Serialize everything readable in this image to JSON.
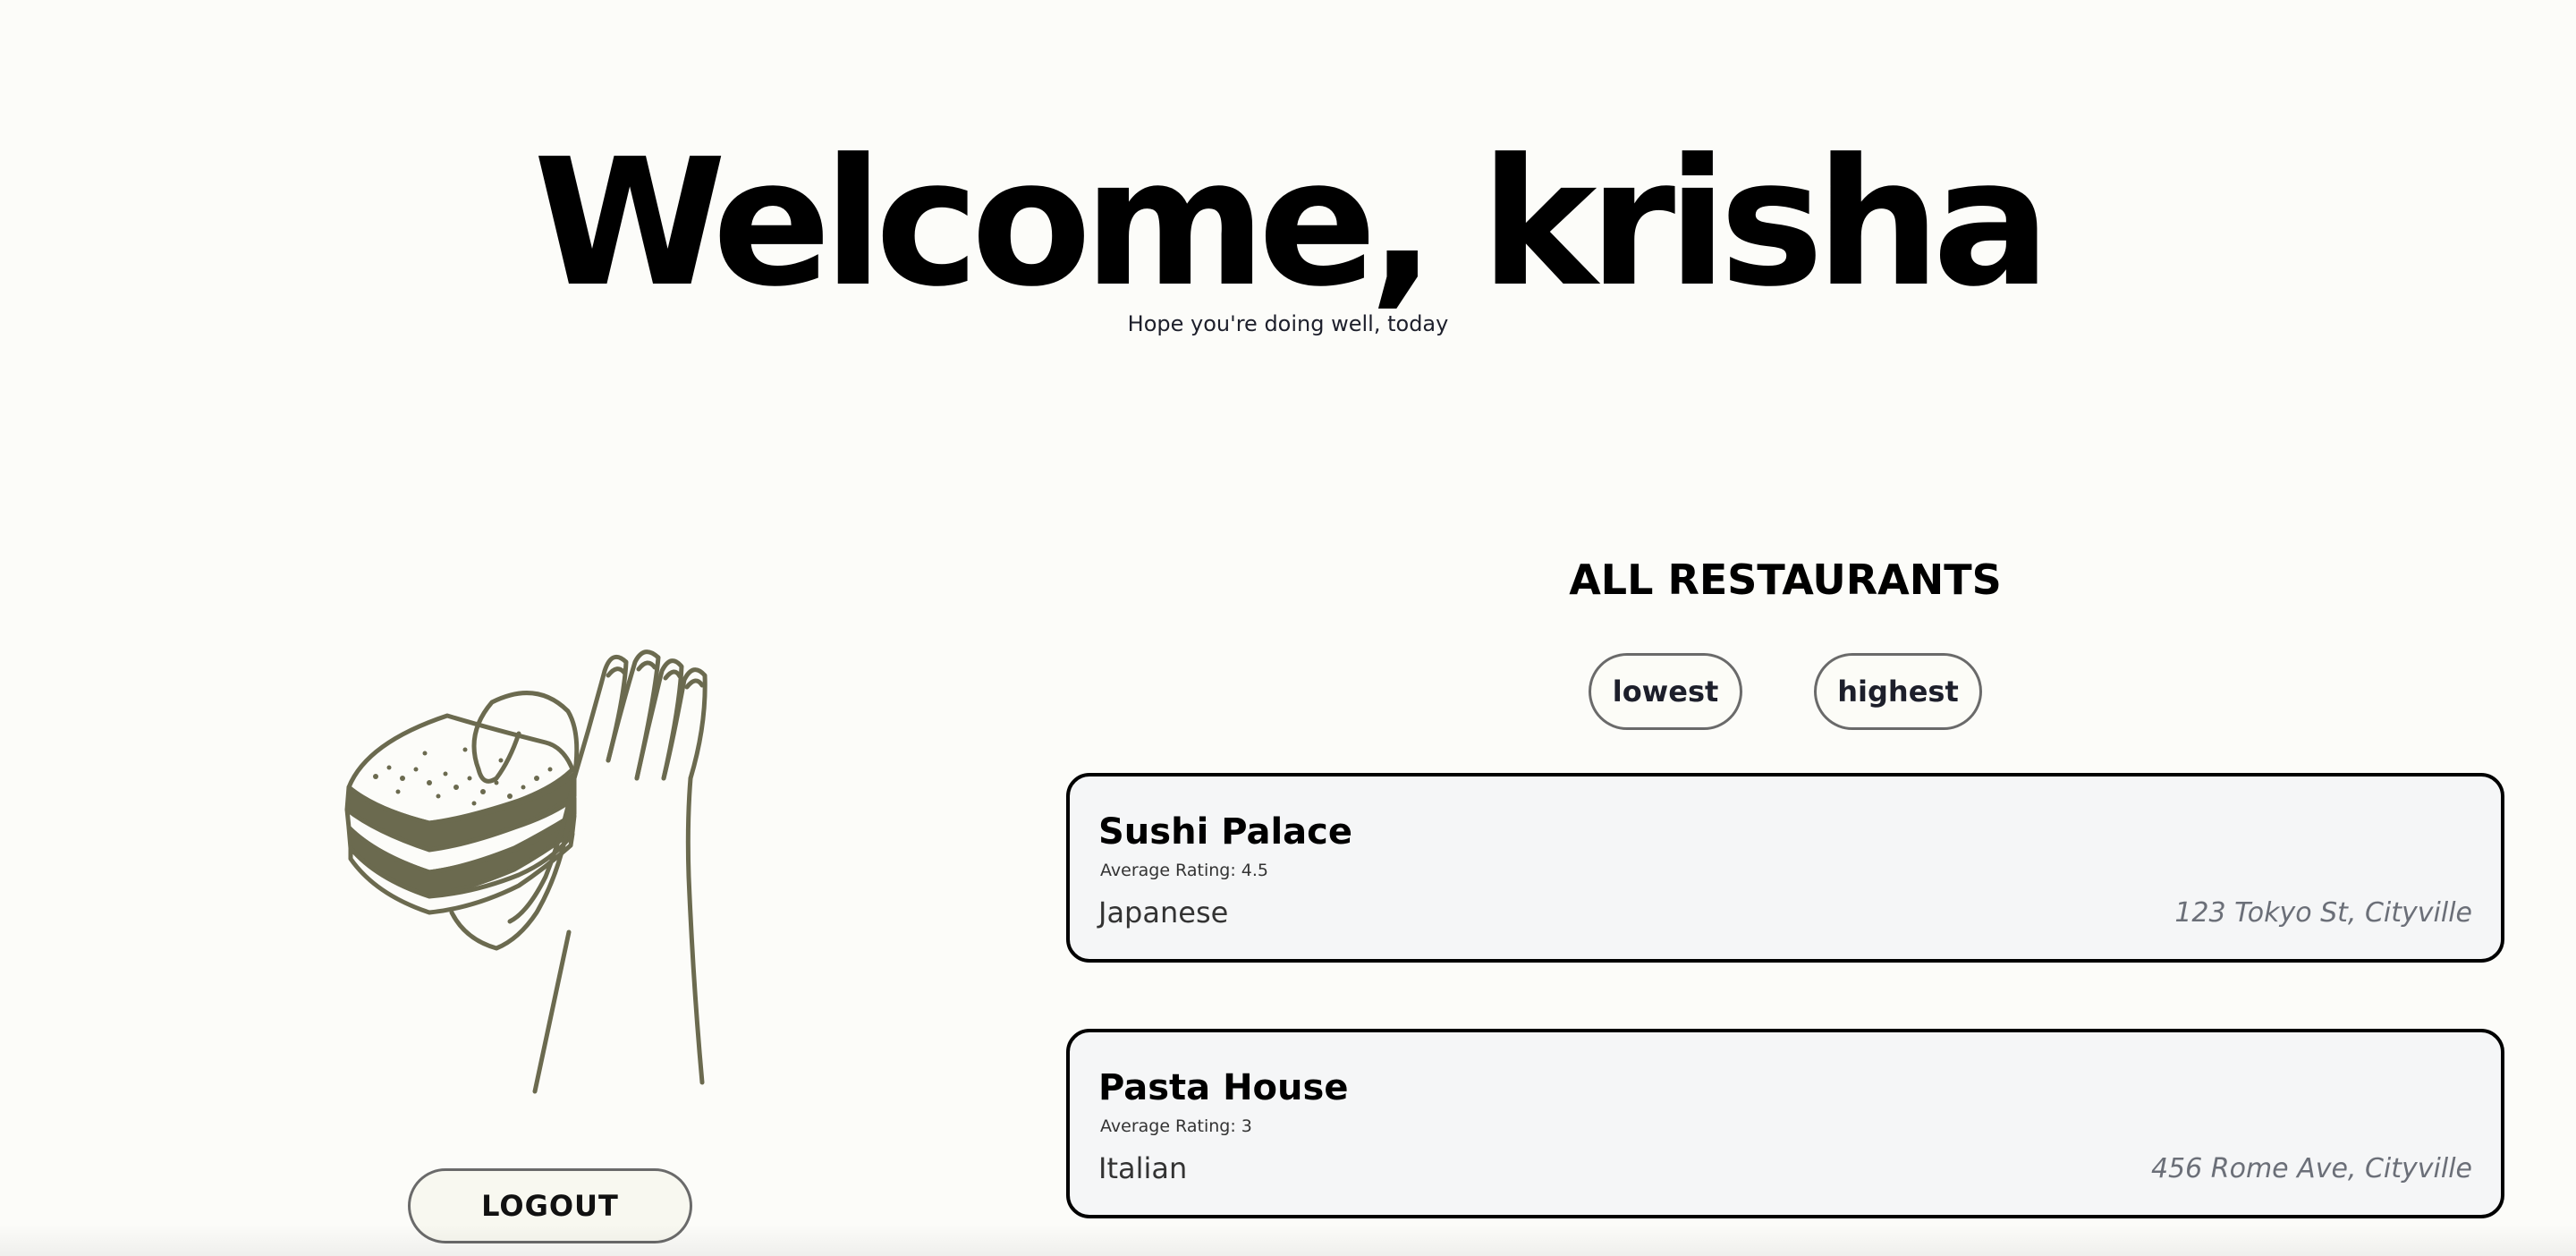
{
  "header": {
    "title": "Welcome, krisha",
    "subtitle": "Hope you're doing well, today"
  },
  "sidebar": {
    "illustration": "hand-holding-sandwich-illustration",
    "logout_label": "LOGOUT"
  },
  "main": {
    "section_title": "ALL RESTAURANTS",
    "sort_buttons": [
      {
        "label": "lowest"
      },
      {
        "label": "highest"
      }
    ],
    "restaurants": [
      {
        "name": "Sushi Palace",
        "rating": "Average Rating: 4.5",
        "cuisine": "Japanese",
        "address": "123 Tokyo St, Cityville"
      },
      {
        "name": "Pasta House",
        "rating": "Average Rating: 3",
        "cuisine": "Italian",
        "address": "456 Rome Ave, Cityville"
      }
    ]
  },
  "colors": {
    "background": "#fcfcf9",
    "illustration_stroke": "#6b6a4f",
    "card_background": "#f5f6f7",
    "card_border": "#000000",
    "button_border": "#6a6a6a"
  }
}
